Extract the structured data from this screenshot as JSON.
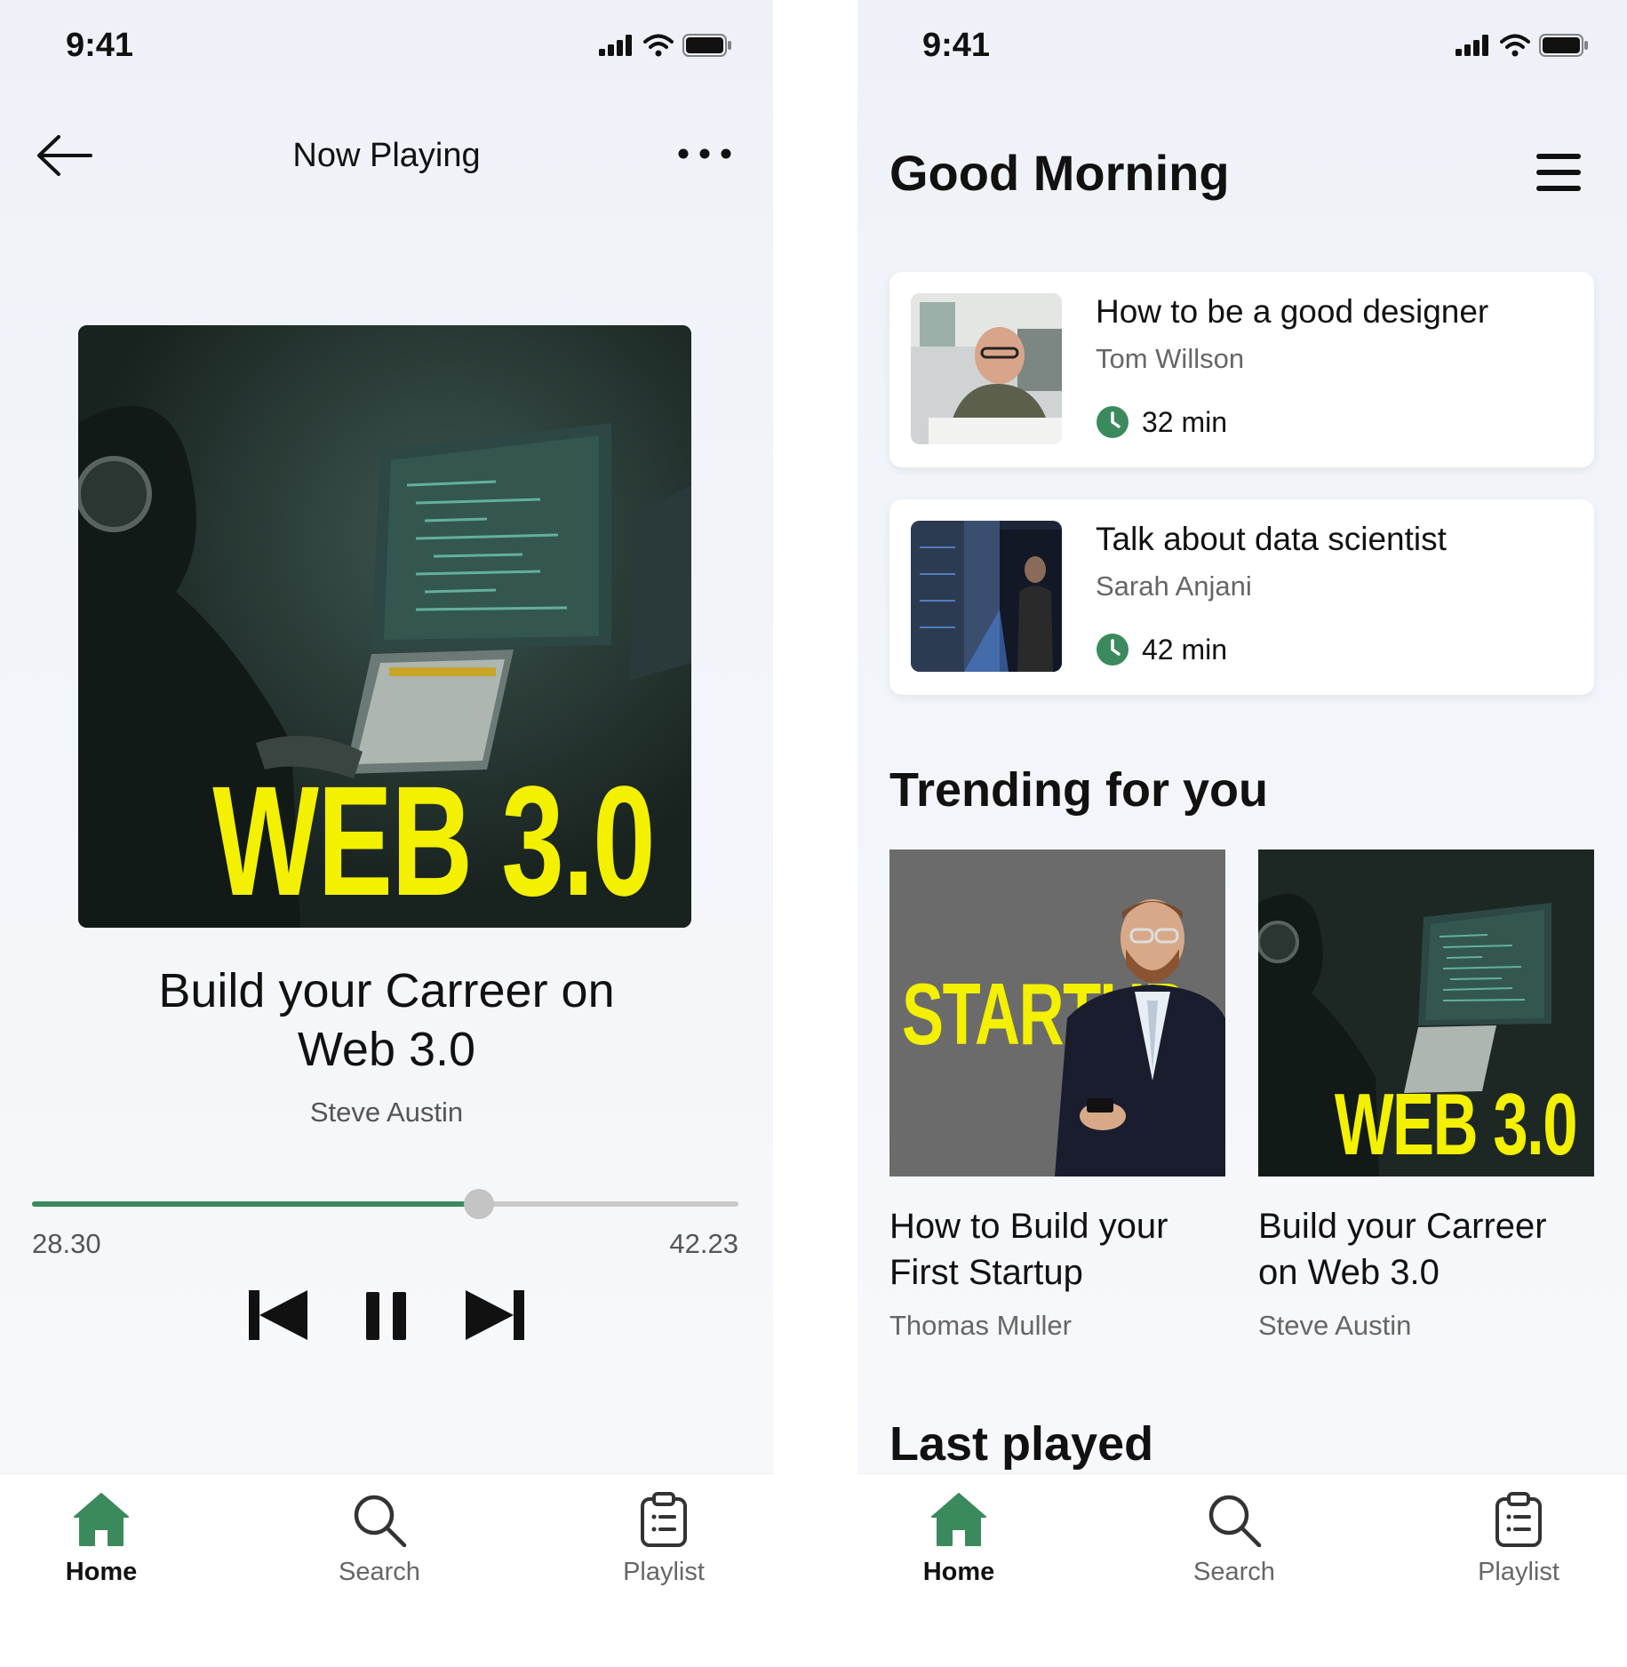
{
  "status_bar": {
    "time": "9:41"
  },
  "now_playing": {
    "header_title": "Now Playing",
    "cover_text": "WEB 3.0",
    "track_title_line1": "Build your Carreer on",
    "track_title_line2": "Web 3.0",
    "artist": "Steve Austin",
    "progress_fraction": 0.633,
    "time_current": "28.30",
    "time_total": "42.23"
  },
  "home": {
    "greeting": "Good Morning",
    "recent": [
      {
        "title": "How to be a good designer",
        "author": "Tom Willson",
        "duration": "32 min"
      },
      {
        "title": "Talk about data scientist",
        "author": "Sarah Anjani",
        "duration": "42 min"
      }
    ],
    "trending_heading": "Trending for you",
    "trending": [
      {
        "title_line1": "How to Build your",
        "title_line2": "First Startup",
        "author": "Thomas Muller",
        "cover_text": "STARTUP"
      },
      {
        "title_line1": "Build your Carreer",
        "title_line2": "on Web 3.0",
        "author": "Steve Austin",
        "cover_text": "WEB 3.0"
      }
    ],
    "last_played_heading": "Last played"
  },
  "nav": {
    "home": "Home",
    "search": "Search",
    "playlist": "Playlist"
  },
  "colors": {
    "accent": "#3b8a5e",
    "cover_yellow": "#f3f000",
    "cover_dark": "#1f2b27",
    "startup_bg": "#6b6b6b"
  },
  "icons": [
    "back-arrow-icon",
    "more-dots-icon",
    "menu-icon",
    "clock-icon",
    "home-icon",
    "search-icon",
    "playlist-icon",
    "previous-icon",
    "pause-icon",
    "next-icon",
    "signal-icon",
    "wifi-icon",
    "battery-icon"
  ]
}
